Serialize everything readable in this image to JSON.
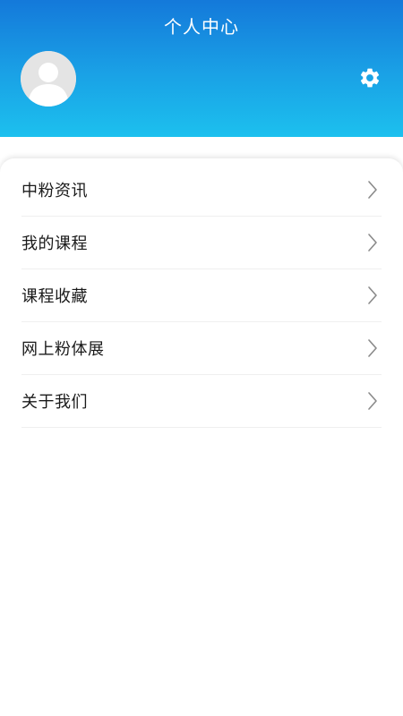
{
  "header": {
    "title": "个人中心",
    "gradient_top": "#1479da",
    "gradient_bottom": "#1cc0ee",
    "avatar_icon": "user-avatar-icon",
    "settings_icon": "gear-icon"
  },
  "menu": {
    "items": [
      {
        "label": "中粉资讯",
        "icon": "chevron-right-icon"
      },
      {
        "label": "我的课程",
        "icon": "chevron-right-icon"
      },
      {
        "label": "课程收藏",
        "icon": "chevron-right-icon"
      },
      {
        "label": "网上粉体展",
        "icon": "chevron-right-icon"
      },
      {
        "label": "关于我们",
        "icon": "chevron-right-icon"
      }
    ]
  }
}
